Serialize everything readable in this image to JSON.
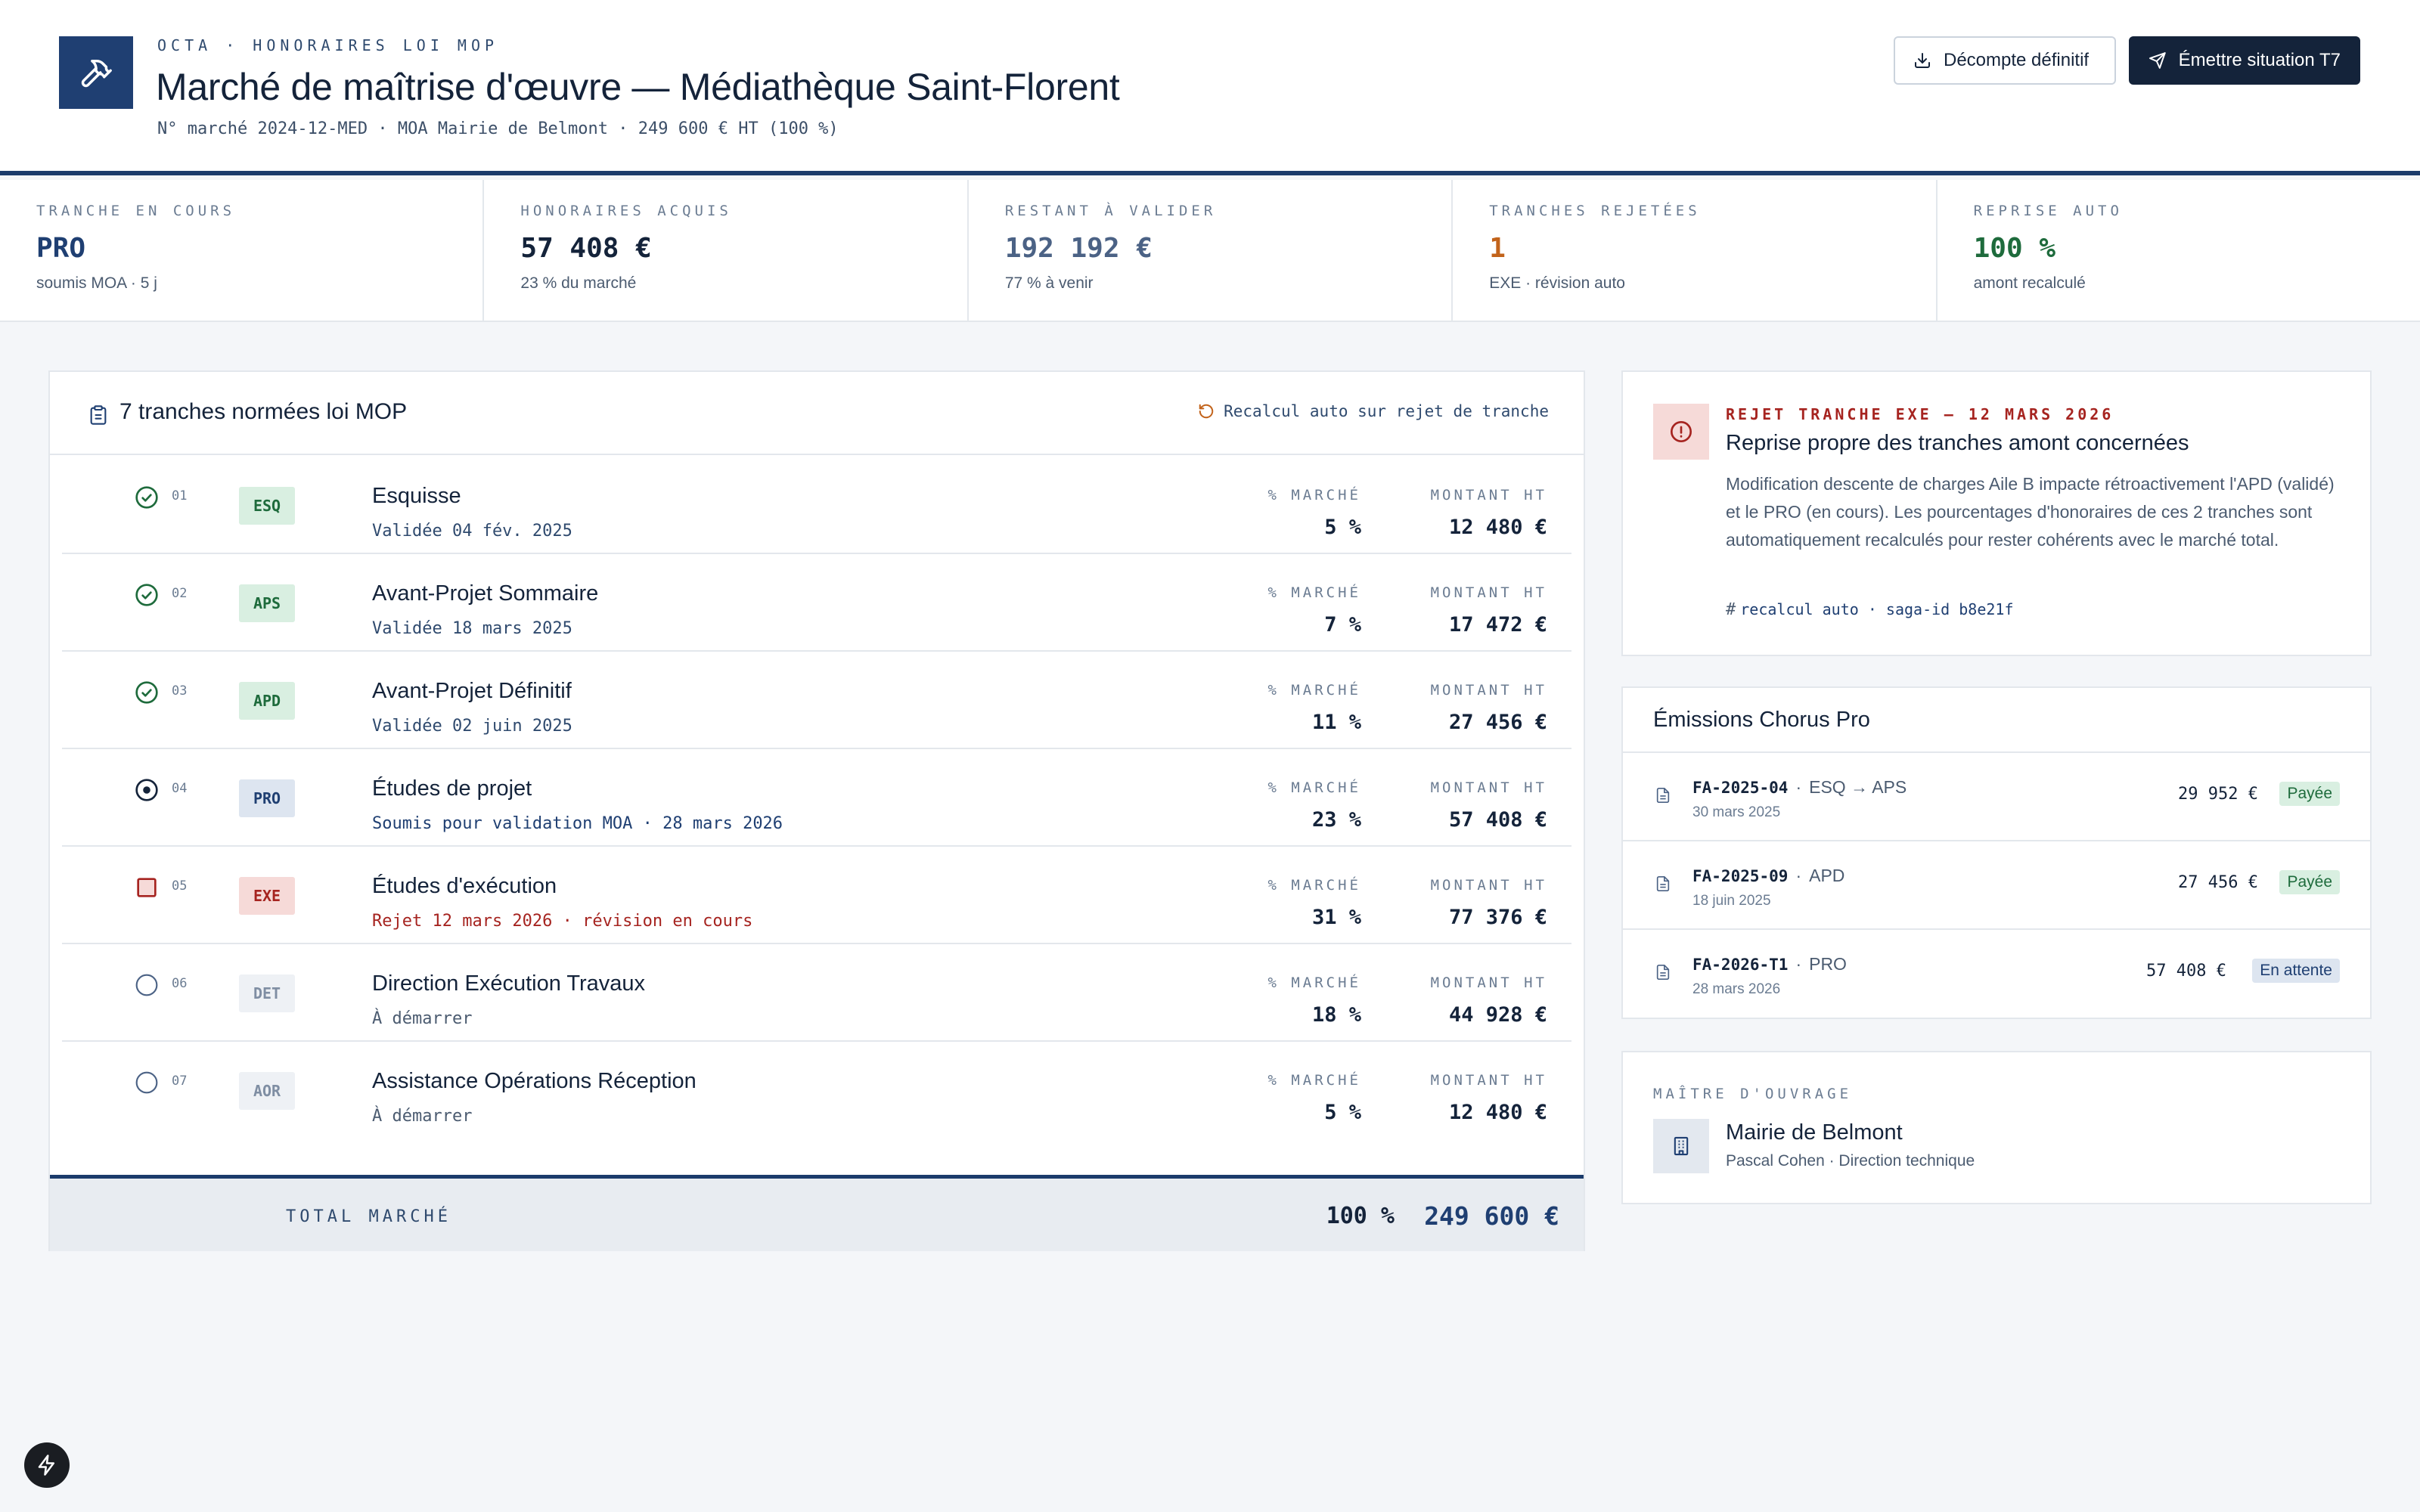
{
  "header": {
    "eyebrow": "OCTA · HONORAIRES LOI MOP",
    "title": "Marché de maîtrise d'œuvre — Médiathèque Saint-Florent",
    "subtitle": "N° marché 2024-12-MED · MOA Mairie de Belmont · 249 600 € HT (100 %)",
    "btn_decompte": "Décompte définitif",
    "btn_emettre": "Émettre situation T7"
  },
  "stats": [
    {
      "label": "TRANCHE EN COURS",
      "value": "PRO",
      "sub": "soumis MOA · 5 j",
      "color": "#1f3f72"
    },
    {
      "label": "HONORAIRES ACQUIS",
      "value": "57 408 €",
      "sub": "23 % du marché",
      "color": "#14233a"
    },
    {
      "label": "RESTANT À VALIDER",
      "value": "192 192 €",
      "sub": "77 % à venir",
      "color": "#4b6285"
    },
    {
      "label": "TRANCHES REJETÉES",
      "value": "1",
      "sub": "EXE · révision auto",
      "color": "#c2631b"
    },
    {
      "label": "REPRISE AUTO",
      "value": "100 %",
      "sub": "amont recalculé",
      "color": "#1e6b3c"
    }
  ],
  "tranches": {
    "title": "7 tranches normées loi MOP",
    "recalc": "Recalcul auto sur rejet de tranche",
    "col_pct": "% MARCHÉ",
    "col_amt": "MONTANT HT",
    "rows": [
      {
        "idx": "01",
        "code": "ESQ",
        "name": "Esquisse",
        "sub": "Validée 04 fév. 2025",
        "pct": "5 %",
        "amt": "12 480 €",
        "status": "done"
      },
      {
        "idx": "02",
        "code": "APS",
        "name": "Avant-Projet Sommaire",
        "sub": "Validée 18 mars 2025",
        "pct": "7 %",
        "amt": "17 472 €",
        "status": "done"
      },
      {
        "idx": "03",
        "code": "APD",
        "name": "Avant-Projet Définitif",
        "sub": "Validée 02 juin 2025",
        "pct": "11 %",
        "amt": "27 456 €",
        "status": "done"
      },
      {
        "idx": "04",
        "code": "PRO",
        "name": "Études de projet",
        "sub": "Soumis pour validation MOA · 28 mars 2026",
        "pct": "23 %",
        "amt": "57 408 €",
        "status": "current"
      },
      {
        "idx": "05",
        "code": "EXE",
        "name": "Études d'exécution",
        "sub": "Rejet 12 mars 2026 · révision en cours",
        "pct": "31 %",
        "amt": "77 376 €",
        "status": "rejected"
      },
      {
        "idx": "06",
        "code": "DET",
        "name": "Direction Exécution Travaux",
        "sub": "À démarrer",
        "pct": "18 %",
        "amt": "44 928 €",
        "status": "todo"
      },
      {
        "idx": "07",
        "code": "AOR",
        "name": "Assistance Opérations Réception",
        "sub": "À démarrer",
        "pct": "5 %",
        "amt": "12 480 €",
        "status": "todo"
      }
    ],
    "total_label": "TOTAL MARCHÉ",
    "total_pct": "100 %",
    "total_amt": "249 600 €"
  },
  "alert": {
    "eyebrow": "REJET TRANCHE EXE — 12 MARS 2026",
    "title": "Reprise propre des tranches amont concernées",
    "body": "Modification descente de charges Aile B impacte rétroactivement l'APD (validé) et le PRO (en cours). Les pourcentages d'honoraires de ces 2 tranches sont automatiquement recalculés pour rester cohérents avec le marché total.",
    "tag": "recalcul auto · saga-id b8e21f"
  },
  "chorus": {
    "title": "Émissions Chorus Pro",
    "rows": [
      {
        "ref": "FA-2025-04",
        "desc": "ESQ → APS",
        "date": "30 mars 2025",
        "amt": "29 952 €",
        "badge": "Payée",
        "state": "paid"
      },
      {
        "ref": "FA-2025-09",
        "desc": "APD",
        "date": "18 juin 2025",
        "amt": "27 456 €",
        "badge": "Payée",
        "state": "paid"
      },
      {
        "ref": "FA-2026-T1",
        "desc": "PRO",
        "date": "28 mars 2026",
        "amt": "57 408 €",
        "badge": "En attente",
        "state": "wait"
      }
    ]
  },
  "moa": {
    "label": "MAÎTRE D'OUVRAGE",
    "name": "Mairie de Belmont",
    "contact": "Pascal Cohen · Direction technique"
  },
  "colors": {
    "navy": "#1f3f72",
    "danger": "#a62420",
    "success": "#1e6b3c",
    "warning": "#c2631b"
  },
  "icons": [
    "hammer-icon",
    "download-icon",
    "send-icon",
    "clipboard-icon",
    "rotate-icon",
    "alert-circle-icon",
    "hash-icon",
    "document-icon",
    "building-icon",
    "bolt-icon"
  ]
}
